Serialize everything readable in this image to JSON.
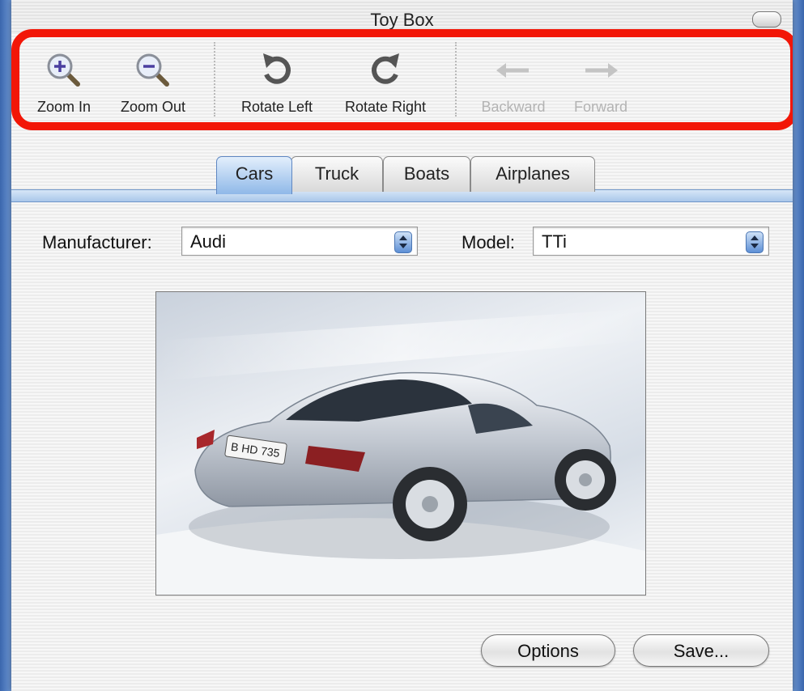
{
  "window": {
    "title": "Toy Box"
  },
  "toolbar": {
    "items": [
      {
        "label": "Zoom In",
        "icon": "zoom-in-icon",
        "enabled": true
      },
      {
        "label": "Zoom Out",
        "icon": "zoom-out-icon",
        "enabled": true
      },
      {
        "label": "Rotate Left",
        "icon": "rotate-left-icon",
        "enabled": true
      },
      {
        "label": "Rotate Right",
        "icon": "rotate-right-icon",
        "enabled": true
      },
      {
        "label": "Backward",
        "icon": "arrow-left-icon",
        "enabled": false
      },
      {
        "label": "Forward",
        "icon": "arrow-right-icon",
        "enabled": false
      }
    ]
  },
  "tabs": [
    {
      "label": "Cars",
      "selected": true
    },
    {
      "label": "Truck",
      "selected": false
    },
    {
      "label": "Boats",
      "selected": false
    },
    {
      "label": "Airplanes",
      "selected": false
    }
  ],
  "form": {
    "manufacturer_label": "Manufacturer:",
    "manufacturer_value": "Audi",
    "model_label": "Model:",
    "model_value": "TTi"
  },
  "photo": {
    "plate_text": "B HD 735"
  },
  "buttons": {
    "options_label": "Options",
    "save_label": "Save..."
  },
  "colors": {
    "highlight": "#f21607",
    "accent": "#5d8fd5"
  }
}
